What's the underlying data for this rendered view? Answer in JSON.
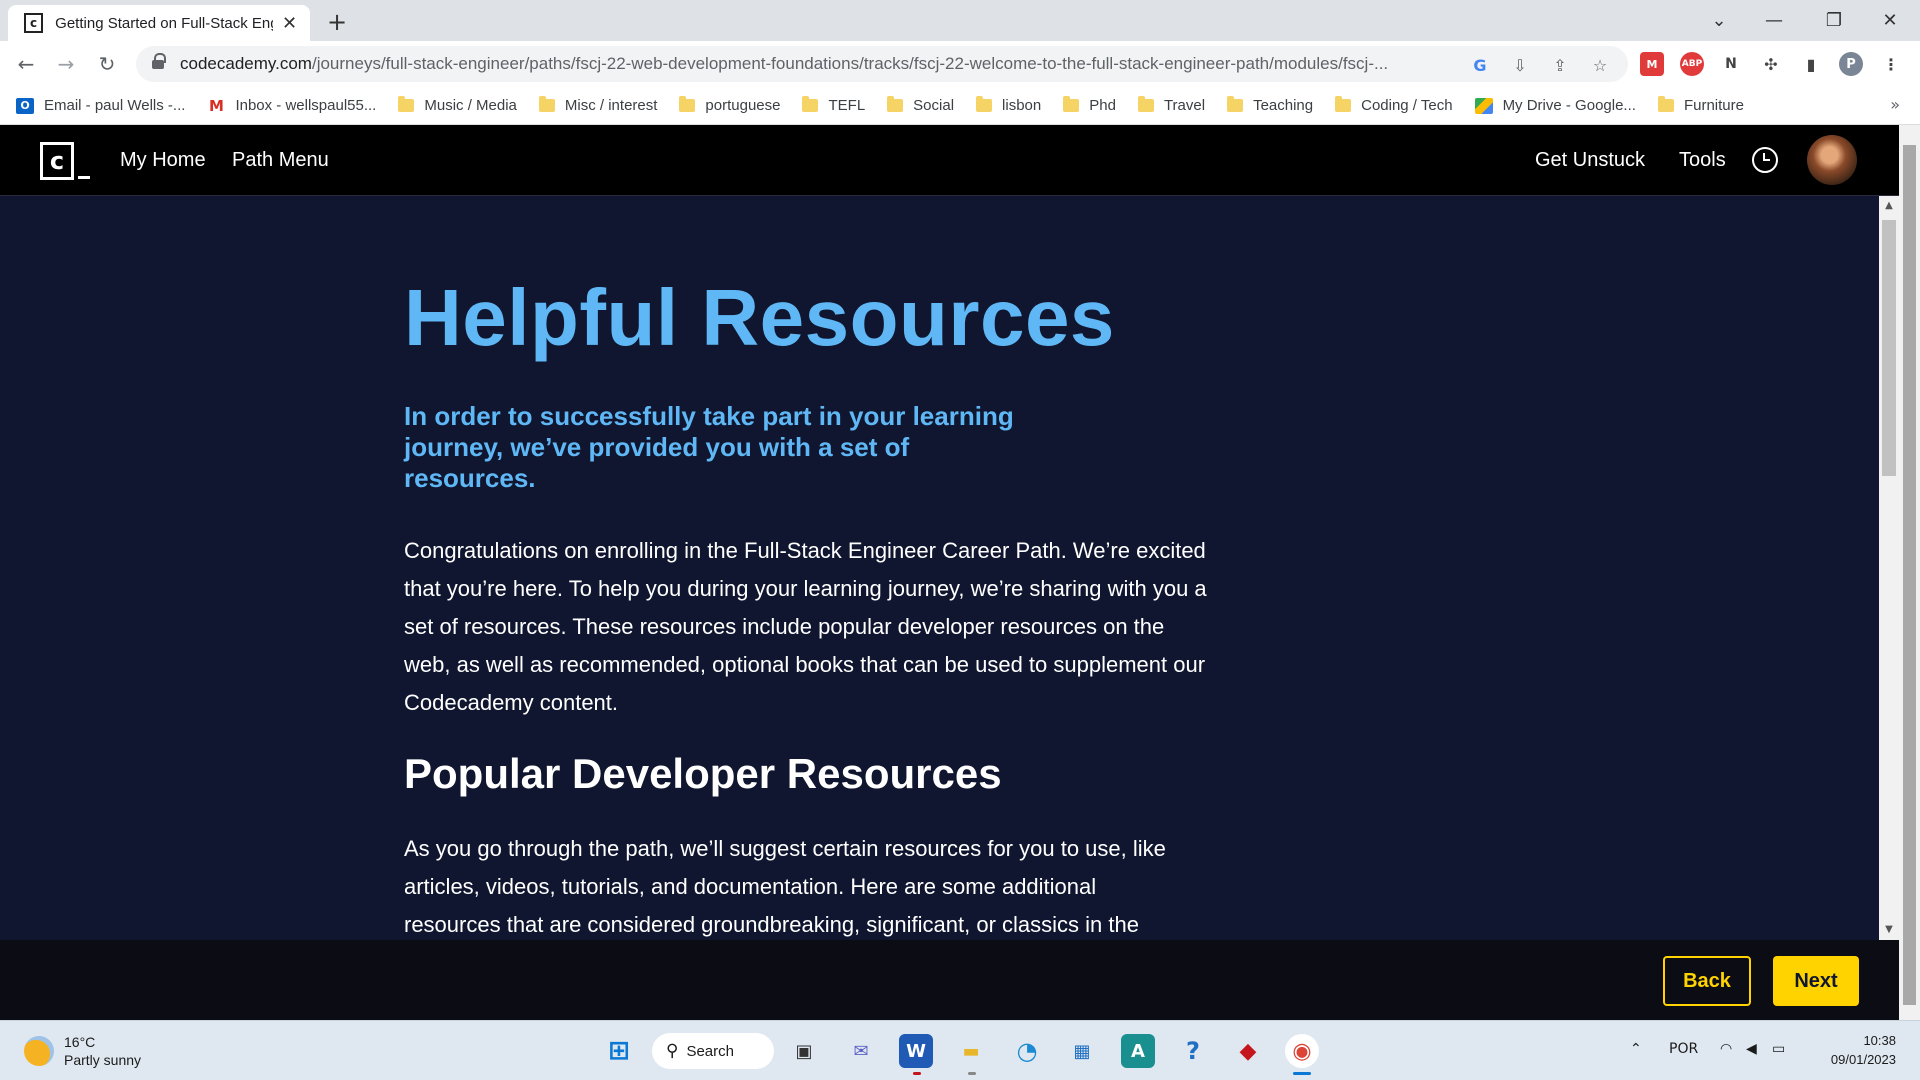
{
  "browser": {
    "tab_title": "Getting Started on Full-Stack Eng",
    "url_host": "codecademy.com",
    "url_path": "/journeys/full-stack-engineer/paths/fscj-22-web-development-foundations/tracks/fscj-22-welcome-to-the-full-stack-engineer-path/modules/fscj-...",
    "profile_initial": "P",
    "bookmarks": [
      {
        "label": "Email - paul Wells -...",
        "icon": "outlook-icon"
      },
      {
        "label": "Inbox - wellspaul55...",
        "icon": "gmail-icon"
      },
      {
        "label": "Music / Media",
        "icon": "folder-icon"
      },
      {
        "label": "Misc / interest",
        "icon": "folder-icon"
      },
      {
        "label": "portuguese",
        "icon": "folder-icon"
      },
      {
        "label": "TEFL",
        "icon": "folder-icon"
      },
      {
        "label": "Social",
        "icon": "folder-icon"
      },
      {
        "label": "lisbon",
        "icon": "folder-icon"
      },
      {
        "label": "Phd",
        "icon": "folder-icon"
      },
      {
        "label": "Travel",
        "icon": "folder-icon"
      },
      {
        "label": "Teaching",
        "icon": "folder-icon"
      },
      {
        "label": "Coding / Tech",
        "icon": "folder-icon"
      },
      {
        "label": "My Drive - Google...",
        "icon": "drive-icon"
      },
      {
        "label": "Furniture",
        "icon": "folder-icon"
      }
    ]
  },
  "header": {
    "logo_letter": "c",
    "my_home": "My Home",
    "path_menu": "Path Menu",
    "get_unstuck": "Get Unstuck",
    "tools": "Tools"
  },
  "article": {
    "title": "Helpful Resources",
    "lead": "In order to successfully take part in your learning journey, we’ve provided you with a set of resources.",
    "paragraph1": "Congratulations on enrolling in the Full-Stack Engineer Career Path. We’re excited that you’re here. To help you during your learning journey, we’re sharing with you a set of resources. These resources include popular developer resources on the web, as well as recommended, optional books that can be used to supplement our Codecademy content.",
    "heading2": "Popular Developer Resources",
    "paragraph2": "As you go through the path, we’ll suggest certain resources for you to use, like articles, videos, tutorials, and documentation. Here are some additional resources that are considered groundbreaking, significant, or classics in the"
  },
  "footer": {
    "back": "Back",
    "next": "Next"
  },
  "taskbar": {
    "temperature": "16°C",
    "weather": "Partly sunny",
    "search": "Search",
    "language": "POR",
    "time": "10:38",
    "date": "09/01/2023"
  },
  "colors": {
    "accent_blue": "#5fb8f5",
    "content_bg": "#10162f",
    "button_yellow": "#ffd300"
  }
}
